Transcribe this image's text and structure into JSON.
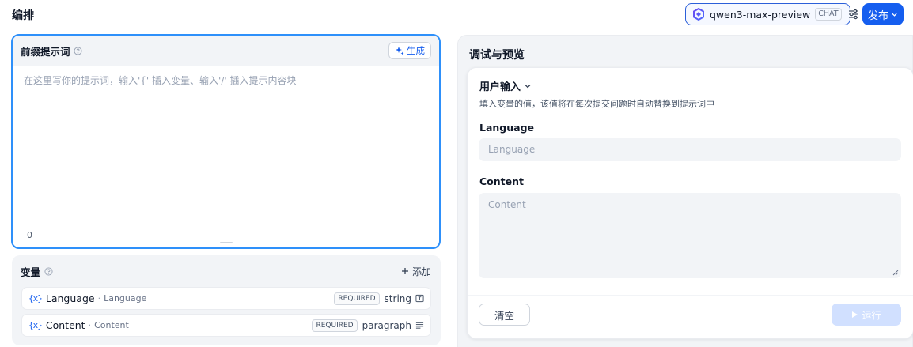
{
  "header": {
    "title": "编排",
    "model": {
      "name": "qwen3-max-preview",
      "tag": "CHAT"
    },
    "publish_label": "发布"
  },
  "prompt": {
    "title": "前缀提示词",
    "generate_label": "生成",
    "placeholder": "在这里写你的提示词，输入'{' 插入变量、输入'/' 插入提示内容块",
    "char_count": "0"
  },
  "variables": {
    "title": "变量",
    "add_label": "添加",
    "items": [
      {
        "key": "Language",
        "label": "Language",
        "required": "REQUIRED",
        "type": "string"
      },
      {
        "key": "Content",
        "label": "Content",
        "required": "REQUIRED",
        "type": "paragraph"
      }
    ]
  },
  "preview": {
    "title": "调试与预览",
    "user_input_label": "用户输入",
    "description": "填入变量的值，该值将在每次提交问题时自动替换到提示词中",
    "fields": [
      {
        "label": "Language",
        "placeholder": "Language"
      },
      {
        "label": "Content",
        "placeholder": "Content"
      }
    ],
    "clear_label": "清空",
    "run_label": "运行"
  },
  "colors": {
    "accent": "#155eef",
    "focus_border": "#2e90fa",
    "panel_bg": "#f2f4f7"
  }
}
